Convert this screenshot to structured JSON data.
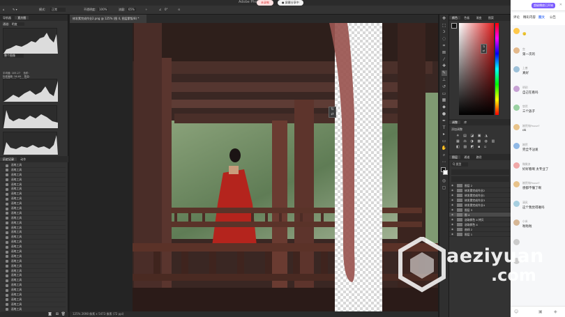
{
  "app": {
    "title": "Adobe Photos",
    "pill_record": "未录制",
    "pill_share": "● 屏幕分享中"
  },
  "options_bar": {
    "mode_label": "模式:",
    "mode_value": "正常",
    "opacity_label": "不透明度:",
    "opacity_value": "100%",
    "flow_label": "流量:",
    "flow_value": "65%",
    "smooth_value": "0°"
  },
  "document_tab": "修发素完成作业2.png @ 125% (图 4, 图层蒙版/8) *",
  "left_panel": {
    "tabs": [
      "导航器",
      "直方图"
    ],
    "channel_label": "通道:",
    "channel_value": "明度",
    "source_label": "整个图像",
    "stats": [
      [
        "平均值:",
        "105.27",
        "色阶:",
        ""
      ],
      [
        "标准偏差:",
        "56.69",
        "数量:",
        ""
      ],
      [
        "中间值:",
        "108",
        "百分位:",
        ""
      ],
      [
        "像素:",
        "2177数7",
        "高速缓存级别:",
        "4"
      ]
    ],
    "history_tabs": [
      "历史记录",
      "动作"
    ],
    "history_items": [
      "画笔工具",
      "画笔工具",
      "画笔工具",
      "画笔工具",
      "画笔工具",
      "画笔工具",
      "画笔工具",
      "画笔工具",
      "画笔工具",
      "画笔工具",
      "画笔工具",
      "画笔工具",
      "画笔工具",
      "画笔工具",
      "画笔工具",
      "画笔工具",
      "画笔工具",
      "画笔工具",
      "画笔工具",
      "画笔工具",
      "画笔工具",
      "画笔工具",
      "画笔工具",
      "画笔工具",
      "画笔工具",
      "画笔工具",
      "画笔工具",
      "画笔工具",
      "画笔工具",
      "画笔工具",
      "画笔工具",
      "画笔工具"
    ],
    "history_last": "修改所有图层"
  },
  "status_bar": "125%    2698 像素 x 5473 像素 (72 ppi)",
  "right_panel": {
    "color_tabs": [
      "颜色",
      "色板",
      "渐变",
      "图案"
    ],
    "adjust_tabs": [
      "调整",
      "库"
    ],
    "adjust_label": "添加调整",
    "layer_tabs": [
      "图层",
      "通道",
      "路径"
    ],
    "kind_label": "Q 类型",
    "layers": [
      "图层 2",
      "修发素完成作业2",
      "修发素完成作业1",
      "修发素完成作业3",
      "修发素完成作业4",
      "图层 3",
      "图 4",
      "选取颜色 4 拷贝",
      "选取颜色 4",
      "曲线 2",
      "图层 1"
    ],
    "selected_layer_index": 6,
    "accent_red": "#e84a3a"
  },
  "chat": {
    "banner": "超级播放已开始",
    "tabs": [
      "评论",
      "精彩内容",
      "图文",
      "公告"
    ],
    "active_tab": "图文",
    "messages": [
      {
        "name": "",
        "text": "🙂",
        "color": "#ffc84a"
      },
      {
        "name": "宫",
        "text": "第一次的",
        "color": "#e3b98c"
      },
      {
        "name": "上善",
        "text": "真好",
        "color": "#9ec1d9"
      },
      {
        "name": "明玥",
        "text": "自己在看吗",
        "color": "#c7a2d4"
      },
      {
        "name": "悠然",
        "text": "三个族子",
        "color": "#9ad1a2"
      },
      {
        "name": "婉然纯Pause?",
        "text": "ok",
        "color": "#e8c38a"
      },
      {
        "name": "婉然",
        "text": "完全不沾发",
        "color": "#8fb8e6"
      },
      {
        "name": "微微凉",
        "text": "好好看啊 太专业了",
        "color": "#f0a8a8"
      },
      {
        "name": "婉然纯Pause?",
        "text": "感都不懂了啊",
        "color": "#e8c38a"
      },
      {
        "name": "清风",
        "text": "这个我觉得难吗",
        "color": "#a7cfe0"
      },
      {
        "name": "小米",
        "text": "啦啦啦",
        "color": "#d6b796"
      },
      {
        "name": "",
        "text": "",
        "color": "#cccccc"
      },
      {
        "name": "",
        "text": "",
        "color": "#cccccc"
      }
    ]
  },
  "watermark": {
    "brand": "aeziyuan",
    "suffix": ".com"
  }
}
